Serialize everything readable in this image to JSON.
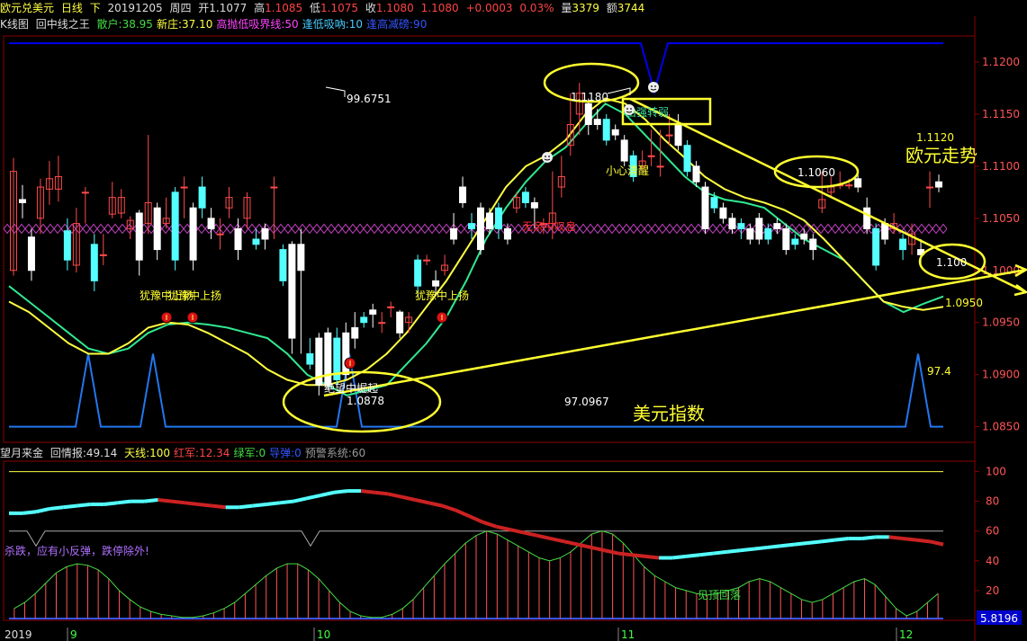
{
  "header": {
    "symbol": "欧元兑美元",
    "period": "日线",
    "sub": "下",
    "date": "20191205",
    "weekday": "周四",
    "open_label": "开",
    "open": "1.1077",
    "high_label": "高",
    "high": "1.1085",
    "low_label": "低",
    "low": "1.1075",
    "close_label": "收",
    "close": "1.1080",
    "last": "1.1080",
    "change": "+0.0003",
    "change_pct": "0.03%",
    "volume_label": "量",
    "volume": "3379",
    "amount_label": "额",
    "amount": "3744"
  },
  "main_indicator": {
    "name": "K线图",
    "formula": "回中线之王",
    "items": [
      {
        "text": "散户:38.95",
        "color": "#44dd44"
      },
      {
        "text": "新庄:37.10",
        "color": "#ffff44"
      },
      {
        "text": "高抛低吸界线:50",
        "color": "#ff44ff"
      },
      {
        "text": "逢低吸吶:10",
        "color": "#44ccff"
      },
      {
        "text": "逢高减磅:90",
        "color": "#3355ff"
      }
    ]
  },
  "lower_indicator": {
    "name": "望月来金",
    "formula": "回情报:49.14",
    "items": [
      {
        "text": "天线:100",
        "color": "#ffff44"
      },
      {
        "text": "红军:12.34",
        "color": "#ff4444"
      },
      {
        "text": "绿军:0",
        "color": "#44dd44"
      },
      {
        "text": "导弹:0",
        "color": "#3355ff"
      },
      {
        "text": "预警系统:60",
        "color": "#999999"
      }
    ]
  },
  "colors": {
    "up": "#ff4a4a",
    "down": "#54ffff",
    "white_candle": "#ffffff",
    "ma_green": "#30e890",
    "ma_yellow": "#ffff40",
    "trend_yellow": "#ffff30",
    "indicator_blue": "#2277ee",
    "cross_magenta": "#c040c0",
    "grid_red": "#8a0000",
    "navy_line": "#0000ee",
    "annotation_red": "#ff3030"
  },
  "chart_data": {
    "type": "candlestick",
    "y_axis_ticks": [
      "1.1200",
      "1.1150",
      "1.1100",
      "1.1050",
      "1.1000",
      "1.0950",
      "1.0900",
      "1.0850"
    ],
    "ylim": [
      1.0835,
      1.1225
    ],
    "x_axis_labels": [
      "2019",
      "9",
      "10",
      "11",
      "12"
    ],
    "lower_ticks": [
      "100",
      "80",
      "60",
      "40",
      "20"
    ],
    "lower_ylim": [
      0,
      107
    ],
    "lower_last_value": "5.8196",
    "candles": [
      [
        1.1,
        1.1095,
        1.1108,
        1.0995
      ],
      [
        1.1068,
        1.1065,
        1.1082,
        1.105
      ],
      [
        1.1032,
        1.1,
        1.104,
        1.099
      ],
      [
        1.105,
        1.108,
        1.1088,
        1.1035
      ],
      [
        1.1078,
        1.1088,
        1.1105,
        1.1063
      ],
      [
        1.1078,
        1.109,
        1.111,
        1.1066
      ],
      [
        1.1038,
        1.101,
        1.105,
        1.1
      ],
      [
        1.1005,
        1.1045,
        1.106,
        1.0998
      ],
      [
        1.1075,
        1.1075,
        1.108,
        1.1045
      ],
      [
        1.1025,
        1.099,
        1.1035,
        1.098
      ],
      [
        1.1015,
        1.1015,
        1.1035,
        1.1005
      ],
      [
        1.1054,
        1.107,
        1.1085,
        1.105
      ],
      [
        1.1055,
        1.107,
        1.1078,
        1.105
      ],
      [
        1.104,
        1.1048,
        1.1052,
        1.103
      ],
      [
        1.1055,
        1.101,
        1.1058,
        1.0995
      ],
      [
        1.1045,
        1.1065,
        1.113,
        1.1035
      ],
      [
        1.106,
        1.102,
        1.1065,
        1.101
      ],
      [
        1.1045,
        1.105,
        1.107,
        1.104
      ],
      [
        1.1075,
        1.101,
        1.108,
        1.1
      ],
      [
        1.108,
        1.108,
        1.109,
        1.105
      ],
      [
        1.106,
        1.101,
        1.1065,
        1.1
      ],
      [
        1.108,
        1.106,
        1.109,
        1.105
      ],
      [
        1.105,
        1.104,
        1.106,
        1.103
      ],
      [
        1.1035,
        1.1035,
        1.105,
        1.102
      ],
      [
        1.106,
        1.107,
        1.108,
        1.105
      ],
      [
        1.104,
        1.102,
        1.105,
        1.101
      ],
      [
        1.105,
        1.107,
        1.1075,
        1.104
      ],
      [
        1.103,
        1.1025,
        1.104,
        1.102
      ],
      [
        1.104,
        1.103,
        1.1045,
        1.102
      ],
      [
        1.108,
        1.108,
        1.109,
        1.103
      ],
      [
        1.102,
        1.099,
        1.1025,
        1.0985
      ],
      [
        1.1025,
        1.0935,
        1.1028,
        1.092
      ],
      [
        1.1025,
        1.1,
        1.104,
        1.092
      ],
      [
        1.092,
        1.091,
        1.0935,
        1.0905
      ],
      [
        1.0935,
        1.089,
        1.094,
        1.088
      ],
      [
        1.094,
        1.089,
        1.0945,
        1.0885
      ],
      [
        1.0935,
        1.0895,
        1.0945,
        1.089
      ],
      [
        1.094,
        1.09,
        1.095,
        1.0895
      ],
      [
        1.0945,
        1.0935,
        1.096,
        1.0925
      ],
      [
        1.0955,
        1.095,
        1.096,
        1.0945
      ],
      [
        1.0962,
        1.0958,
        1.0968,
        1.0945
      ],
      [
        1.095,
        1.095,
        1.096,
        1.094
      ],
      [
        1.0965,
        1.0965,
        1.097,
        1.0955
      ],
      [
        1.096,
        1.094,
        1.0962,
        1.0935
      ],
      [
        1.095,
        1.0955,
        1.096,
        1.094
      ],
      [
        1.101,
        1.0985,
        1.1015,
        1.0975
      ],
      [
        1.101,
        1.101,
        1.1015,
        1.1005
      ],
      [
        1.099,
        1.0985,
        1.1,
        1.0975
      ],
      [
        1.1,
        1.1005,
        1.1015,
        1.0995
      ],
      [
        1.104,
        1.103,
        1.1055,
        1.1025
      ],
      [
        1.108,
        1.1065,
        1.109,
        1.106
      ],
      [
        1.1045,
        1.104,
        1.1055,
        1.103
      ],
      [
        1.106,
        1.102,
        1.1065,
        1.1015
      ],
      [
        1.1055,
        1.104,
        1.106,
        1.1035
      ],
      [
        1.106,
        1.104,
        1.1065,
        1.103
      ],
      [
        1.104,
        1.103,
        1.1045,
        1.1025
      ],
      [
        1.106,
        1.107,
        1.1075,
        1.1055
      ],
      [
        1.1075,
        1.1065,
        1.108,
        1.106
      ],
      [
        1.1065,
        1.106,
        1.107,
        1.104
      ],
      [
        1.1045,
        1.1045,
        1.105,
        1.1035
      ],
      [
        1.1045,
        1.1055,
        1.1095,
        1.103
      ],
      [
        1.108,
        1.109,
        1.111,
        1.107
      ],
      [
        1.112,
        1.114,
        1.117,
        1.111
      ],
      [
        1.115,
        1.117,
        1.118,
        1.113
      ],
      [
        1.116,
        1.114,
        1.1165,
        1.113
      ],
      [
        1.1145,
        1.114,
        1.1155,
        1.1135
      ],
      [
        1.1145,
        1.1125,
        1.115,
        1.112
      ],
      [
        1.1135,
        1.113,
        1.114,
        1.1125
      ],
      [
        1.1125,
        1.1105,
        1.113,
        1.11
      ],
      [
        1.111,
        1.109,
        1.1115,
        1.1085
      ],
      [
        1.11,
        1.1105,
        1.1115,
        1.1095
      ],
      [
        1.111,
        1.111,
        1.1135,
        1.11
      ],
      [
        1.11,
        1.11,
        1.1135,
        1.109
      ],
      [
        1.113,
        1.113,
        1.115,
        1.112
      ],
      [
        1.114,
        1.112,
        1.115,
        1.1115
      ],
      [
        1.112,
        1.1095,
        1.1125,
        1.109
      ],
      [
        1.11,
        1.1085,
        1.1105,
        1.108
      ],
      [
        1.108,
        1.104,
        1.1085,
        1.1035
      ],
      [
        1.107,
        1.106,
        1.1075,
        1.1055
      ],
      [
        1.106,
        1.105,
        1.1065,
        1.1045
      ],
      [
        1.105,
        1.104,
        1.1055,
        1.1035
      ],
      [
        1.1045,
        1.104,
        1.105,
        1.103
      ],
      [
        1.104,
        1.103,
        1.1045,
        1.1025
      ],
      [
        1.105,
        1.103,
        1.1055,
        1.1025
      ],
      [
        1.104,
        1.103,
        1.1045,
        1.1025
      ],
      [
        1.1045,
        1.104,
        1.105,
        1.1035
      ],
      [
        1.104,
        1.102,
        1.1045,
        1.1015
      ],
      [
        1.103,
        1.1025,
        1.1035,
        1.102
      ],
      [
        1.1035,
        1.103,
        1.104,
        1.1025
      ],
      [
        1.103,
        1.102,
        1.1035,
        1.101
      ],
      [
        1.106,
        1.1068,
        1.1095,
        1.1055
      ],
      [
        1.1075,
        1.108,
        1.109,
        1.107
      ],
      [
        1.1082,
        1.1082,
        1.1095,
        1.1078
      ],
      [
        1.1082,
        1.1082,
        1.1088,
        1.1078
      ],
      [
        1.1088,
        1.108,
        1.1092,
        1.1075
      ],
      [
        1.106,
        1.104,
        1.107,
        1.1035
      ],
      [
        1.104,
        1.1005,
        1.1045,
        1.1
      ],
      [
        1.1045,
        1.103,
        1.105,
        1.1025
      ],
      [
        1.104,
        1.1045,
        1.1055,
        1.1035
      ],
      [
        1.103,
        1.102,
        1.1035,
        1.101
      ],
      [
        1.1025,
        1.1035,
        1.1045,
        1.1015
      ],
      [
        1.102,
        1.1015,
        1.103,
        1.1005
      ],
      [
        1.108,
        1.108,
        1.1095,
        1.106
      ],
      [
        1.1085,
        1.108,
        1.1092,
        1.1075
      ]
    ],
    "ma_green": [
      1.0985,
      1.097,
      1.0955,
      1.094,
      1.0925,
      1.092,
      1.0925,
      1.094,
      1.0948,
      1.095,
      1.0948,
      1.0945,
      1.094,
      1.0935,
      1.092,
      1.09,
      1.089,
      1.088,
      1.0885,
      1.089,
      1.091,
      1.093,
      1.0955,
      1.099,
      1.103,
      1.106,
      1.1085,
      1.1105,
      1.1118,
      1.114,
      1.116,
      1.115,
      1.113,
      1.111,
      1.109,
      1.1075,
      1.1068,
      1.1065,
      1.106,
      1.1045,
      1.103,
      1.102,
      1.101,
      1.099,
      1.097,
      1.096,
      1.0968,
      1.0975
    ],
    "ma_yellow": [
      1.097,
      1.096,
      1.0945,
      1.093,
      1.092,
      1.092,
      1.093,
      1.0945,
      1.095,
      1.0948,
      1.094,
      1.093,
      1.092,
      1.0905,
      1.0895,
      1.089,
      1.089,
      1.0895,
      1.0905,
      1.092,
      1.094,
      1.0965,
      1.099,
      1.102,
      1.105,
      1.108,
      1.11,
      1.111,
      1.1125,
      1.115,
      1.1165,
      1.116,
      1.1145,
      1.1125,
      1.1108,
      1.109,
      1.1078,
      1.107,
      1.1065,
      1.1058,
      1.1048,
      1.103,
      1.101,
      1.099,
      1.097,
      1.0965,
      1.0962,
      1.0965
    ],
    "cross_level": 1.104,
    "navy_top_level": 1.1218,
    "blue_baseline": 1.085,
    "blue_spikes": [
      {
        "x": 98,
        "peak": 1.092
      },
      {
        "x": 170,
        "peak": 1.092
      },
      {
        "x": 388,
        "peak": 1.092
      },
      {
        "x": 1020,
        "peak": 1.092
      }
    ],
    "annotations": {
      "high1": "99.6751",
      "low1": "97.0967",
      "top_price": "1.1180",
      "price_1060": "1.1060",
      "price_1120": "1.1120",
      "price_100": "1.100",
      "price_0950": "1.0950",
      "price_0878": "1.0878",
      "val_974": "97.4",
      "label_eur": "欧元走势",
      "label_usd": "美元指数",
      "hesitate_up": "犹豫中上扬",
      "hesitate_up2": "犹豫中上扬",
      "hesitate_up_overlap": "犹豫中上扬",
      "careful_wake": "小心清醒",
      "no_worry": "无亲中叹息",
      "turn_weak": "由强转弱",
      "bottom_drop": "绝望中崛起",
      "lower_text_left": "杀跌，应有小反弹，跌停除外!",
      "lower_text_right": "见顶回落"
    },
    "lower_histogram": [
      8,
      12,
      18,
      25,
      32,
      36,
      38,
      37,
      34,
      28,
      20,
      14,
      9,
      6,
      4,
      3,
      2,
      2,
      3,
      5,
      8,
      12,
      18,
      24,
      30,
      35,
      38,
      38,
      34,
      28,
      20,
      12,
      6,
      3,
      2,
      2,
      4,
      8,
      14,
      22,
      30,
      38,
      45,
      52,
      57,
      60,
      58,
      54,
      50,
      46,
      42,
      40,
      42,
      46,
      52,
      58,
      60,
      58,
      52,
      44,
      36,
      30,
      26,
      22,
      20,
      18,
      17,
      18,
      20,
      22,
      26,
      28,
      26,
      22,
      18,
      14,
      12,
      14,
      18,
      22,
      26,
      28,
      24,
      16,
      8,
      3,
      6,
      12,
      18
    ],
    "lower_line_cyan_red": [
      72,
      72,
      73,
      75,
      76,
      77,
      78,
      78,
      79,
      80,
      80,
      81,
      80,
      79,
      78,
      77,
      76,
      76,
      77,
      78,
      79,
      80,
      82,
      84,
      86,
      87,
      87,
      86,
      85,
      83,
      81,
      79,
      77,
      74,
      70,
      66,
      63,
      61,
      59,
      57,
      55,
      53,
      51,
      49,
      47,
      45,
      44,
      43,
      42,
      42,
      43,
      44,
      45,
      46,
      47,
      48,
      49,
      50,
      51,
      52,
      53,
      54,
      55,
      55,
      56,
      56,
      55,
      54,
      53,
      51
    ]
  }
}
